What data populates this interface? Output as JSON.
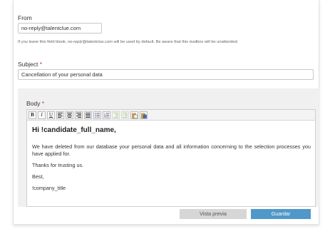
{
  "from": {
    "label": "From",
    "value": "no-reply@talentclue.com",
    "hint_before": "If you leave this field blank, ",
    "hint_email": "no-reply@talentclue.com",
    "hint_after": " will be used by default. Be aware that this mailbox will be unattended."
  },
  "subject": {
    "label": "Subject",
    "required_mark": "*",
    "value": "Cancellation of your personal data"
  },
  "body": {
    "label": "Body",
    "required_mark": "*",
    "toolbar": {
      "bold": "B",
      "italic": "I",
      "underline": "U",
      "icons": [
        "align-left-icon",
        "align-center-icon",
        "align-right-icon",
        "align-justify-icon",
        "bulleted-list-icon",
        "numbered-list-icon",
        "outdent-icon",
        "indent-icon",
        "paste-icon",
        "paste-word-icon"
      ]
    },
    "greeting": "Hi !candidate_full_name,",
    "paragraph1": "We have deleted from our database your personal data and all information concerning to the selection processes you have applied for.",
    "paragraph2": "Thanks for trusting us.",
    "paragraph3": "Best,",
    "paragraph4": "!company_title"
  },
  "actions": {
    "preview_label": "Vista previa",
    "save_label": "Guardar"
  },
  "colors": {
    "required": "#c0392b",
    "primary_button": "#4f98c9",
    "secondary_button": "#d6d6d6"
  }
}
